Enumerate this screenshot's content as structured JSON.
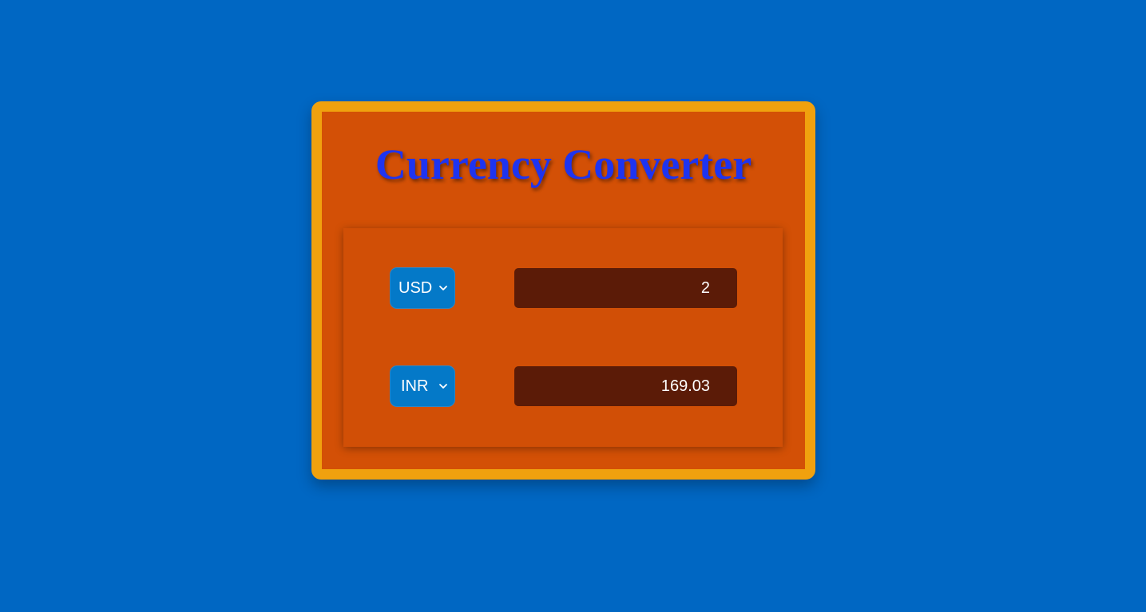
{
  "title": "Currency Converter",
  "converter": {
    "from": {
      "currency": "USD",
      "amount": "2"
    },
    "to": {
      "currency": "INR",
      "amount": "169.03"
    }
  },
  "icons": {
    "dropdown": "chevron-down-icon"
  },
  "colors": {
    "background": "#0067c3",
    "card_border": "#f0a10e",
    "card_fill": "#d35006",
    "title": "#1e34f0",
    "select_fill": "#0479c8",
    "input_fill": "#5b1b07"
  }
}
